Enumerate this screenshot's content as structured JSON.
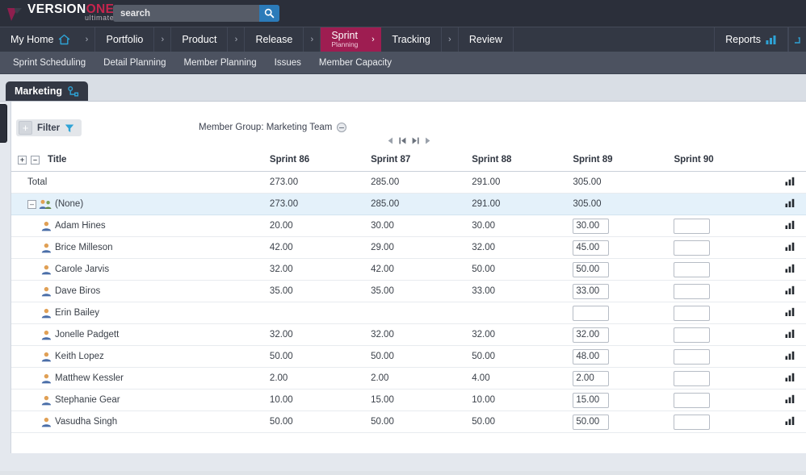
{
  "brand": {
    "name_part1": "VERSION",
    "name_part2": "ONE",
    "edition": "ultimate",
    "accent_color": "#c7254e"
  },
  "search": {
    "placeholder": "search",
    "value": "",
    "icon": "search-icon"
  },
  "mainnav": {
    "home": "My Home",
    "home_icon": "home-icon",
    "items": [
      "Portfolio",
      "Product",
      "Release"
    ],
    "active": {
      "line1": "Sprint",
      "line2": "Planning"
    },
    "after_active": [
      "Tracking",
      "Review"
    ],
    "separator": "›",
    "reports": "Reports",
    "reports_icon": "bar-chart-icon",
    "active_color": "#9e1d51"
  },
  "subnav": {
    "items": [
      "Sprint Scheduling",
      "Detail Planning",
      "Member Planning",
      "Issues",
      "Member Capacity"
    ]
  },
  "project_tab": {
    "label": "Marketing",
    "icon": "project-tree-icon"
  },
  "toolbar": {
    "filter_label": "Filter",
    "filter_add_icon": "plus-icon",
    "filter_icon": "funnel-icon",
    "member_group": "Member Group: Marketing Team",
    "member_group_remove_icon": "remove-circle-icon",
    "pager": [
      "prev-page-icon",
      "first-page-icon",
      "last-page-icon",
      "next-page-icon"
    ]
  },
  "table": {
    "expand_all_icon": "expand-all-icon",
    "collapse_all_icon": "collapse-all-icon",
    "columns": [
      "Title",
      "Sprint 86",
      "Sprint 87",
      "Sprint 88",
      "Sprint 89",
      "Sprint 90"
    ],
    "row_chart_icon": "bar-chart-icon",
    "total": {
      "label": "Total",
      "sprint86": "273.00",
      "sprint87": "285.00",
      "sprint88": "291.00",
      "sprint89": "305.00",
      "sprint90": ""
    },
    "group": {
      "label": "(None)",
      "toggle_icon": "collapse-icon",
      "group_icon": "members-group-icon",
      "sprint86": "273.00",
      "sprint87": "285.00",
      "sprint88": "291.00",
      "sprint89": "305.00",
      "sprint90": ""
    },
    "members": [
      {
        "name": "Adam Hines",
        "icon": "member-icon",
        "sprint86": "20.00",
        "sprint87": "30.00",
        "sprint88": "30.00",
        "sprint89": "30.00",
        "sprint90": ""
      },
      {
        "name": "Brice Milleson",
        "icon": "member-icon",
        "sprint86": "42.00",
        "sprint87": "29.00",
        "sprint88": "32.00",
        "sprint89": "45.00",
        "sprint90": ""
      },
      {
        "name": "Carole Jarvis",
        "icon": "member-icon",
        "sprint86": "32.00",
        "sprint87": "42.00",
        "sprint88": "50.00",
        "sprint89": "50.00",
        "sprint90": ""
      },
      {
        "name": "Dave Biros",
        "icon": "member-icon",
        "sprint86": "35.00",
        "sprint87": "35.00",
        "sprint88": "33.00",
        "sprint89": "33.00",
        "sprint90": ""
      },
      {
        "name": "Erin Bailey",
        "icon": "member-icon",
        "sprint86": "",
        "sprint87": "",
        "sprint88": "",
        "sprint89": "",
        "sprint90": ""
      },
      {
        "name": "Jonelle Padgett",
        "icon": "member-icon",
        "sprint86": "32.00",
        "sprint87": "32.00",
        "sprint88": "32.00",
        "sprint89": "32.00",
        "sprint90": ""
      },
      {
        "name": "Keith Lopez",
        "icon": "member-icon",
        "sprint86": "50.00",
        "sprint87": "50.00",
        "sprint88": "50.00",
        "sprint89": "48.00",
        "sprint90": ""
      },
      {
        "name": "Matthew Kessler",
        "icon": "member-icon",
        "sprint86": "2.00",
        "sprint87": "2.00",
        "sprint88": "4.00",
        "sprint89": "2.00",
        "sprint90": ""
      },
      {
        "name": "Stephanie Gear",
        "icon": "member-icon",
        "sprint86": "10.00",
        "sprint87": "15.00",
        "sprint88": "10.00",
        "sprint89": "15.00",
        "sprint90": ""
      },
      {
        "name": "Vasudha Singh",
        "icon": "member-icon",
        "sprint86": "50.00",
        "sprint87": "50.00",
        "sprint88": "50.00",
        "sprint89": "50.00",
        "sprint90": ""
      }
    ]
  }
}
